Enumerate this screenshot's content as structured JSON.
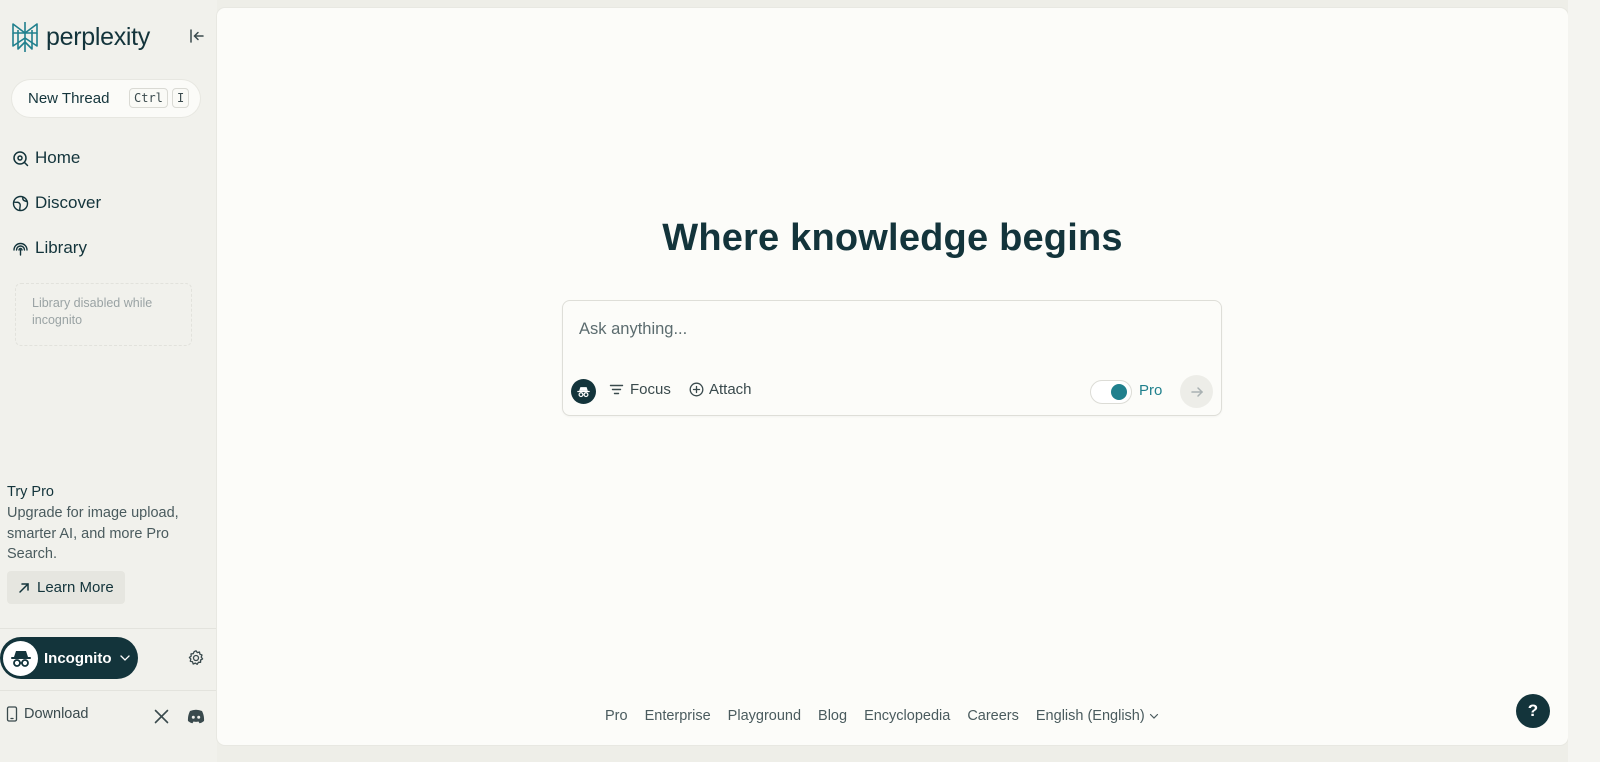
{
  "app": {
    "brand": "perplexity",
    "accent_color": "#20808d",
    "dark_color": "#13343b"
  },
  "sidebar": {
    "new_thread": {
      "label": "New Thread",
      "shortcut_keys": [
        "Ctrl",
        "I"
      ]
    },
    "nav": [
      {
        "label": "Home",
        "icon": "home-search-icon"
      },
      {
        "label": "Discover",
        "icon": "globe-icon"
      },
      {
        "label": "Library",
        "icon": "library-icon"
      }
    ],
    "library_notice": "Library disabled while incognito",
    "try_pro": {
      "title": "Try Pro",
      "description": "Upgrade for image upload, smarter AI, and more Pro Search.",
      "button": "Learn More"
    },
    "account": {
      "label": "Incognito",
      "icon": "incognito-icon"
    },
    "download_label": "Download"
  },
  "main": {
    "title": "Where knowledge begins",
    "ask": {
      "placeholder": "Ask anything...",
      "focus_label": "Focus",
      "attach_label": "Attach",
      "pro_label": "Pro",
      "pro_enabled": true
    },
    "footer": {
      "links": [
        "Pro",
        "Enterprise",
        "Playground",
        "Blog",
        "Encyclopedia",
        "Careers"
      ],
      "language": "English (English)"
    },
    "help_label": "?"
  }
}
